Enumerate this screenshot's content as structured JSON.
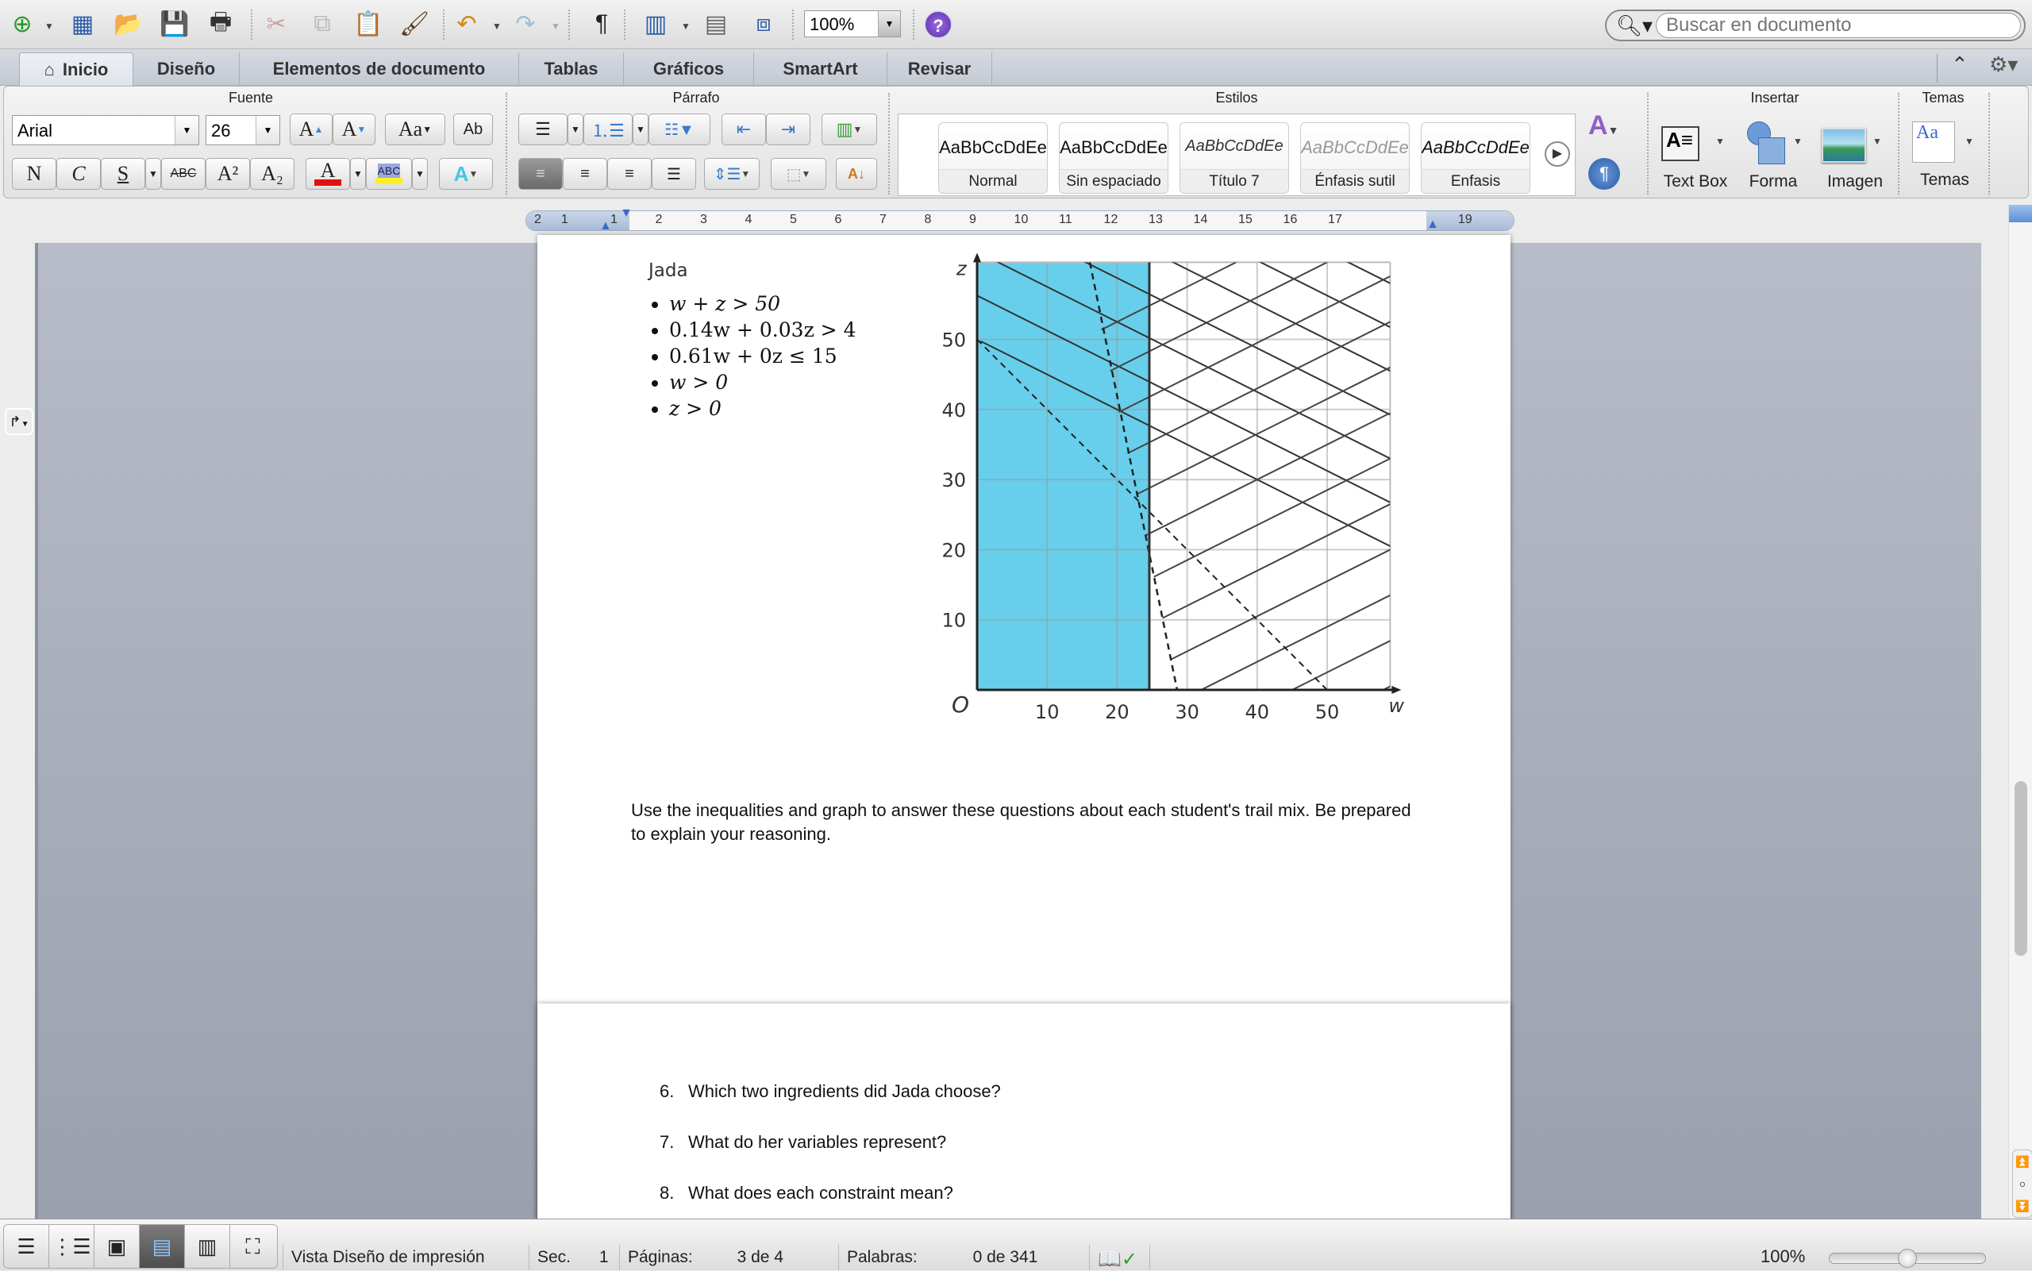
{
  "toolbar": {
    "buttons": [
      "new-document",
      "templates-gallery",
      "open",
      "save",
      "print",
      "cut",
      "copy",
      "paste",
      "format-painter",
      "undo",
      "redo",
      "show-formatting",
      "sidebar",
      "toolbox",
      "media-browser"
    ],
    "zoom_value": "100%",
    "help_label": "?",
    "search_placeholder": "Buscar en documento"
  },
  "tabs": [
    {
      "label": "Inicio",
      "active": true,
      "icon": "home-icon"
    },
    {
      "label": "Diseño",
      "active": false
    },
    {
      "label": "Elementos de documento",
      "active": false
    },
    {
      "label": "Tablas",
      "active": false
    },
    {
      "label": "Gráficos",
      "active": false
    },
    {
      "label": "SmartArt",
      "active": false
    },
    {
      "label": "Revisar",
      "active": false
    }
  ],
  "ribbon": {
    "groups": {
      "font": "Fuente",
      "paragraph": "Párrafo",
      "styles": "Estilos",
      "insert": "Insertar",
      "themes": "Temas"
    },
    "font_name": "Arial",
    "font_size": "26",
    "format_buttons": {
      "bold": "N",
      "italic": "C",
      "underline": "S",
      "strikethrough": "ABC",
      "superscript": "A²",
      "subscript": "A₂"
    },
    "font_color": "#e01010",
    "highlight_color": "#ffee22",
    "styles": [
      {
        "sample": "AaBbCcDdEe",
        "name": "Normal"
      },
      {
        "sample": "AaBbCcDdEe",
        "name": "Sin espaciado"
      },
      {
        "sample": "AaBbCcDdEe",
        "name": "Título 7"
      },
      {
        "sample": "AaBbCcDdEe",
        "name": "Énfasis sutil"
      },
      {
        "sample": "AaBbCcDdEe",
        "name": "Enfasis"
      }
    ],
    "insert_items": [
      {
        "label": "Text Box"
      },
      {
        "label": "Forma"
      },
      {
        "label": "Imagen"
      }
    ],
    "themes_label": "Temas"
  },
  "ruler": {
    "numbers": [
      "2",
      "1",
      "1",
      "2",
      "3",
      "4",
      "5",
      "6",
      "7",
      "8",
      "9",
      "10",
      "11",
      "12",
      "13",
      "14",
      "15",
      "16",
      "17",
      "19"
    ]
  },
  "document": {
    "jada_label": "Jada",
    "inequalities": [
      "w + z > 50",
      "0.14w + 0.03z > 4",
      "0.61w + 0z ≤ 15",
      "w > 0",
      "z > 0"
    ],
    "instructions": "Use the inequalities and graph to answer these questions about each student's trail mix. Be prepared to explain your reasoning.",
    "questions": [
      {
        "num": "6.",
        "text": "Which two ingredients did Jada choose?"
      },
      {
        "num": "7.",
        "text": "What do her variables represent?"
      },
      {
        "num": "8.",
        "text": "What does each constraint mean?"
      }
    ]
  },
  "chart_data": {
    "type": "area",
    "title": "",
    "xlabel": "w",
    "ylabel": "z",
    "origin_label": "O",
    "xlim": [
      0,
      59
    ],
    "ylim": [
      0,
      61
    ],
    "xticks": [
      10,
      20,
      30,
      40,
      50
    ],
    "yticks": [
      10,
      20,
      30,
      40,
      50
    ],
    "grid": true,
    "constraints": [
      {
        "name": "w + z > 50",
        "boundary": "dashed",
        "fill": "hatch-down-right",
        "points": [
          [
            0,
            50
          ],
          [
            50,
            0
          ]
        ]
      },
      {
        "name": "0.14w + 0.03z > 4",
        "boundary": "dashed",
        "fill": "hatch-up-right",
        "points": [
          [
            16.1,
            61
          ],
          [
            28.57,
            0
          ]
        ]
      },
      {
        "name": "0.61w + 0z <= 15",
        "boundary": "solid",
        "fill_color": "#67cfeb",
        "points": [
          [
            24.6,
            0
          ],
          [
            24.6,
            61
          ]
        ]
      }
    ]
  },
  "statusbar": {
    "view_buttons": [
      "draft",
      "outline",
      "publishing",
      "print-layout",
      "notebook",
      "full-screen"
    ],
    "active_view": 3,
    "view_name": "Vista Diseño de impresión",
    "section_label": "Sec.",
    "section_value": "1",
    "pages_label": "Páginas:",
    "pages_value": "3 de 4",
    "words_label": "Palabras:",
    "words_value": "0 de 341",
    "zoom_value": "100%",
    "zoom_fraction": 0.5
  }
}
